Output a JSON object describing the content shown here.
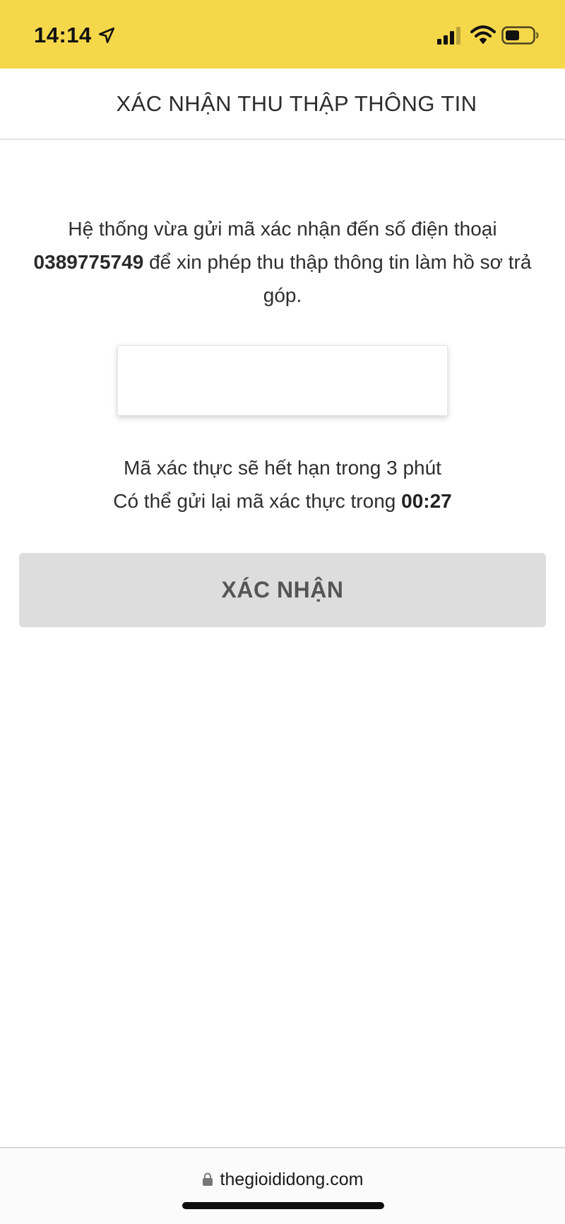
{
  "status_bar": {
    "time": "14:14",
    "icons": [
      "location-arrow-icon",
      "signal-icon",
      "wifi-icon",
      "battery-icon"
    ],
    "background_color": "#f5d74a"
  },
  "header": {
    "title": "XÁC NHẬN THU THẬP THÔNG TIN"
  },
  "message": {
    "prefix": "Hệ thống vừa gửi mã xác nhận đến số điện thoại",
    "phone": "0389775749",
    "suffix": "để xin phép thu thập thông tin làm hồ sơ trả góp."
  },
  "otp_input": {
    "value": "",
    "placeholder": ""
  },
  "expiry_text": "Mã xác thực sẽ hết hạn trong 3 phút",
  "resend": {
    "prefix": "Có thể gửi lại mã xác thực trong",
    "countdown": "00:27"
  },
  "confirm_button": {
    "label": "XÁC NHẬN",
    "state": "disabled"
  },
  "address_bar": {
    "url": "thegioididong.com",
    "icon": "lock-icon"
  }
}
